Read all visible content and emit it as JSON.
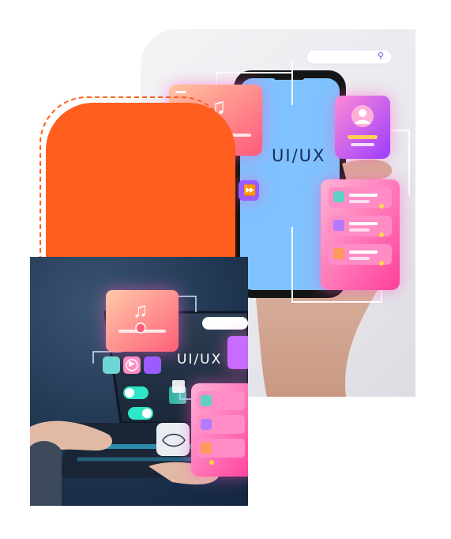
{
  "phone_photo": {
    "screen_text": "UI/UX",
    "search_icon": "search-icon",
    "music_icon": "music-note-icon",
    "profile_icon": "user-icon",
    "forward_icon": "fast-forward-icon"
  },
  "laptop_photo": {
    "screen_text": "UI/UX",
    "music_icon": "music-note-icon",
    "play_icon": "play-icon"
  },
  "colors": {
    "accent_orange": "#ff5e1f",
    "phone_screen": "#7fc2ff",
    "card_pink": "#ff5fa8",
    "card_purple": "#b35cff",
    "laptop_bg": "#1f3550"
  }
}
